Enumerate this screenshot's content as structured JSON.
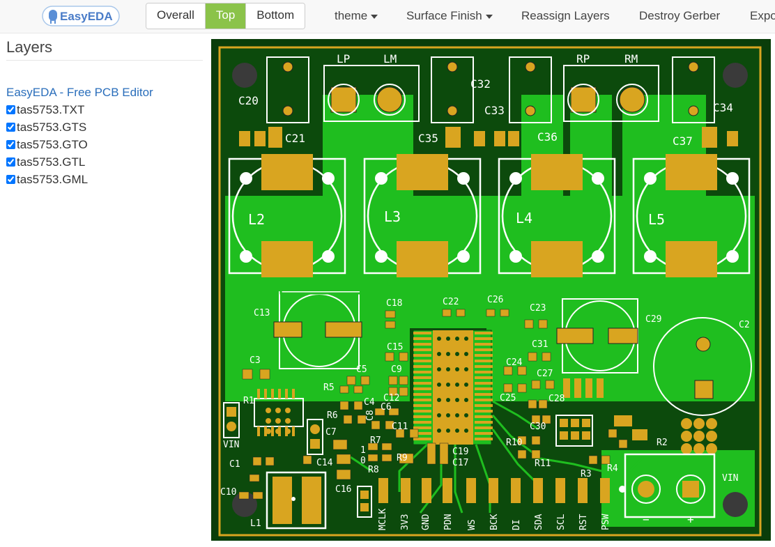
{
  "app": {
    "logo_text": "EasyEDA"
  },
  "view_buttons": [
    {
      "label": "Overall",
      "active": false
    },
    {
      "label": "Top",
      "active": true
    },
    {
      "label": "Bottom",
      "active": false
    }
  ],
  "menu": {
    "theme": "theme",
    "surface_finish": "Surface Finish",
    "reassign_layers": "Reassign Layers",
    "destroy_gerber": "Destroy Gerber",
    "export": "Expo"
  },
  "sidebar": {
    "title": "Layers",
    "editor_link": "EasyEDA - Free PCB Editor",
    "layers": [
      {
        "name": "tas5753.TXT",
        "checked": true
      },
      {
        "name": "tas5753.GTS",
        "checked": true
      },
      {
        "name": "tas5753.GTO",
        "checked": true
      },
      {
        "name": "tas5753.GTL",
        "checked": true
      },
      {
        "name": "tas5753.GML",
        "checked": true
      }
    ]
  },
  "colors": {
    "accent_active": "#8bc34a",
    "board_bg": "#0a3d0a",
    "copper_pour": "#1fbe1f",
    "pad": "#d9a520",
    "silkscreen": "#ffffff"
  },
  "pcb": {
    "ref_c20": "C20",
    "ref_c21": "C21",
    "ref_c32": "C32",
    "ref_c33": "C33",
    "ref_c34": "C34",
    "ref_c35": "C35",
    "ref_c36": "C36",
    "ref_c37": "C37",
    "ref_lp": "LP",
    "ref_lm": "LM",
    "ref_rp": "RP",
    "ref_rm": "RM",
    "ref_l2": "L2",
    "ref_l3": "L3",
    "ref_l4": "L4",
    "ref_l5": "L5",
    "ref_c13": "C13",
    "ref_c18": "C18",
    "ref_c22": "C22",
    "ref_c26": "C26",
    "ref_c23": "C23",
    "ref_c29": "C29",
    "ref_c2": "C2",
    "ref_c15": "C15",
    "ref_c31": "C31",
    "ref_c3": "C3",
    "ref_c5": "C5",
    "ref_c9": "C9",
    "ref_c24": "C24",
    "ref_c27": "C27",
    "ref_r5": "R5",
    "ref_c12": "C12",
    "ref_c25": "C25",
    "ref_c28": "C28",
    "ref_r1": "R1",
    "ref_c4": "C4",
    "ref_c8": "C8",
    "ref_c6": "C6",
    "ref_r6": "R6",
    "ref_c11": "C11",
    "ref_c30": "C30",
    "ref_c7": "C7",
    "ref_r7": "R7",
    "ref_r10": "R10",
    "ref_r2": "R2",
    "ref_vin1": "VIN",
    "ref_c19": "C19",
    "ref_c17": "C17",
    "ref_r9": "R9",
    "ref_r11": "R11",
    "ref_c1": "C1",
    "ref_c14": "C14",
    "ref_r8": "R8",
    "ref_r3": "R3",
    "ref_r4": "R4",
    "ref_vin2": "VIN",
    "ref_c10": "C10",
    "ref_c16": "C16",
    "ref_l1": "L1",
    "ref_one": "1",
    "ref_zero": "0",
    "ref_minus": "−",
    "ref_plus": "+",
    "pin_labels": [
      "MCLK",
      "3V3",
      "GND",
      "PDN",
      "WS",
      "BCK",
      "DI",
      "SDA",
      "SCL",
      "RST",
      "PSW"
    ]
  }
}
